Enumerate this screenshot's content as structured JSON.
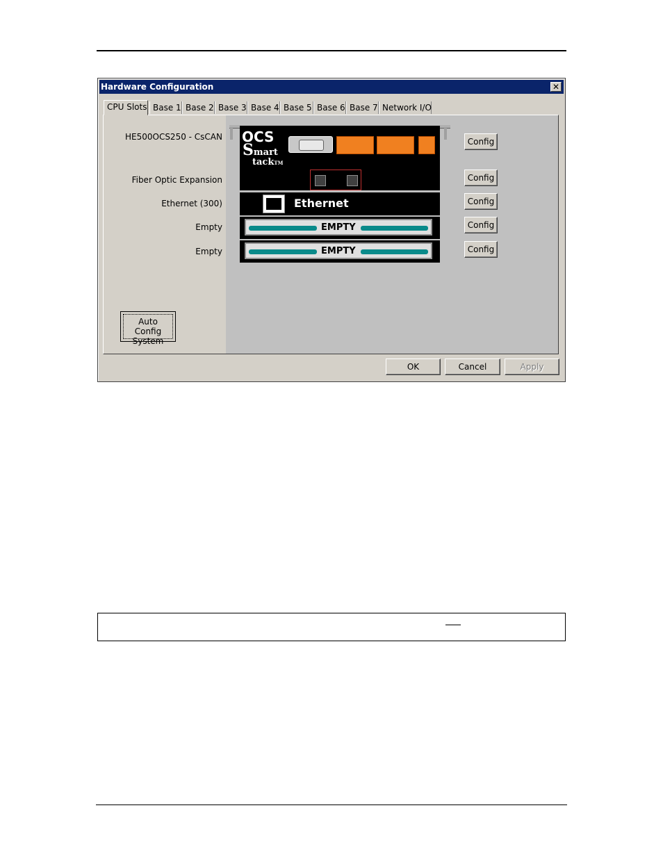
{
  "window": {
    "title": "Hardware Configuration",
    "close_glyph": "✕"
  },
  "tabs": [
    {
      "label": "CPU Slots",
      "active": true
    },
    {
      "label": "Base 1"
    },
    {
      "label": "Base 2"
    },
    {
      "label": "Base 3"
    },
    {
      "label": "Base 4"
    },
    {
      "label": "Base 5"
    },
    {
      "label": "Base 6"
    },
    {
      "label": "Base 7"
    },
    {
      "label": "Network I/O"
    }
  ],
  "slots": [
    {
      "label": "HE500OCS250 - CsCAN",
      "config": "Config"
    },
    {
      "label": "Fiber Optic Expansion",
      "config": "Config"
    },
    {
      "label": "Ethernet (300)",
      "config": "Config"
    },
    {
      "label": "Empty",
      "config": "Config"
    },
    {
      "label": "Empty",
      "config": "Config"
    }
  ],
  "rack": {
    "ocs_title": "OCS",
    "smart_line1": "mart",
    "smart_line2": "tack",
    "smart_initial": "S",
    "trademark": "TM",
    "ethernet_label": "Ethernet",
    "empty_label": "EMPTY",
    "colors": {
      "terminal": "#f08020",
      "empty_bar": "#0a8a8a",
      "titlebar": "#0a246a"
    }
  },
  "auto_config": {
    "line1": "Auto Config",
    "line2": "System"
  },
  "footer_buttons": {
    "ok": "OK",
    "cancel": "Cancel",
    "apply": "Apply"
  }
}
